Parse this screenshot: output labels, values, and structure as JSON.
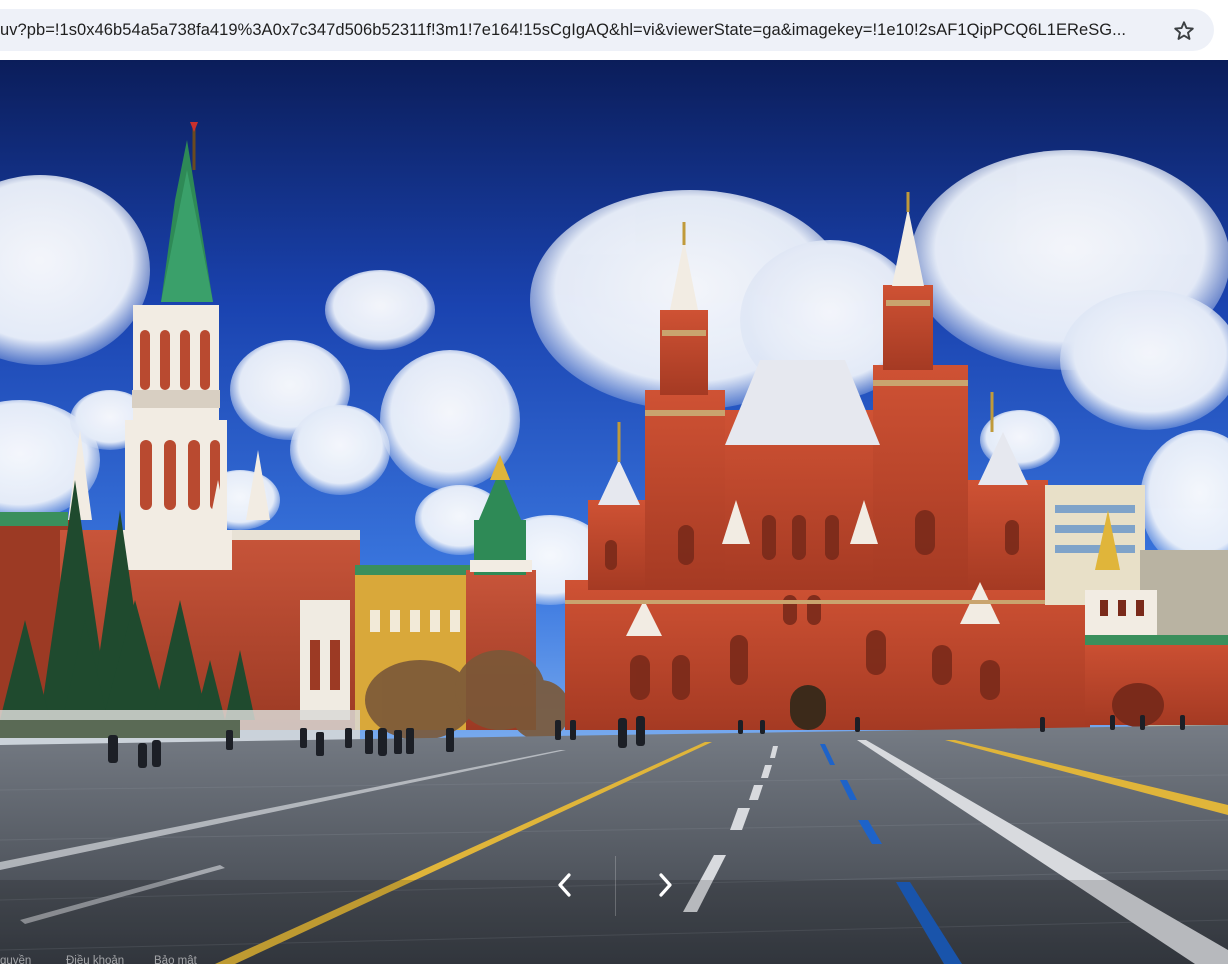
{
  "browser": {
    "url": "uv?pb=!1s0x46b54a5a738fa419%3A0x7c347d506b52311f!3m1!7e164!15sCgIgAQ&hl=vi&viewerState=ga&imagekey=!1e10!2sAF1QipPCQ6L1EReSG...",
    "bookmark_icon": "star-outline-icon"
  },
  "viewer": {
    "prev_icon": "chevron-left-icon",
    "next_icon": "chevron-right-icon"
  },
  "footer": {
    "links": [
      "quyền",
      "Điều khoản",
      "Bảo mật"
    ]
  },
  "colors": {
    "sky": "#1f4fc2",
    "kremlin_brick": "#b94a30",
    "museum_brick": "#c0452c",
    "spire_green": "#2e8a56",
    "pavement": "#4f5660",
    "road_line_yellow": "#e0b53a",
    "road_line_blue": "#1e63c9"
  }
}
